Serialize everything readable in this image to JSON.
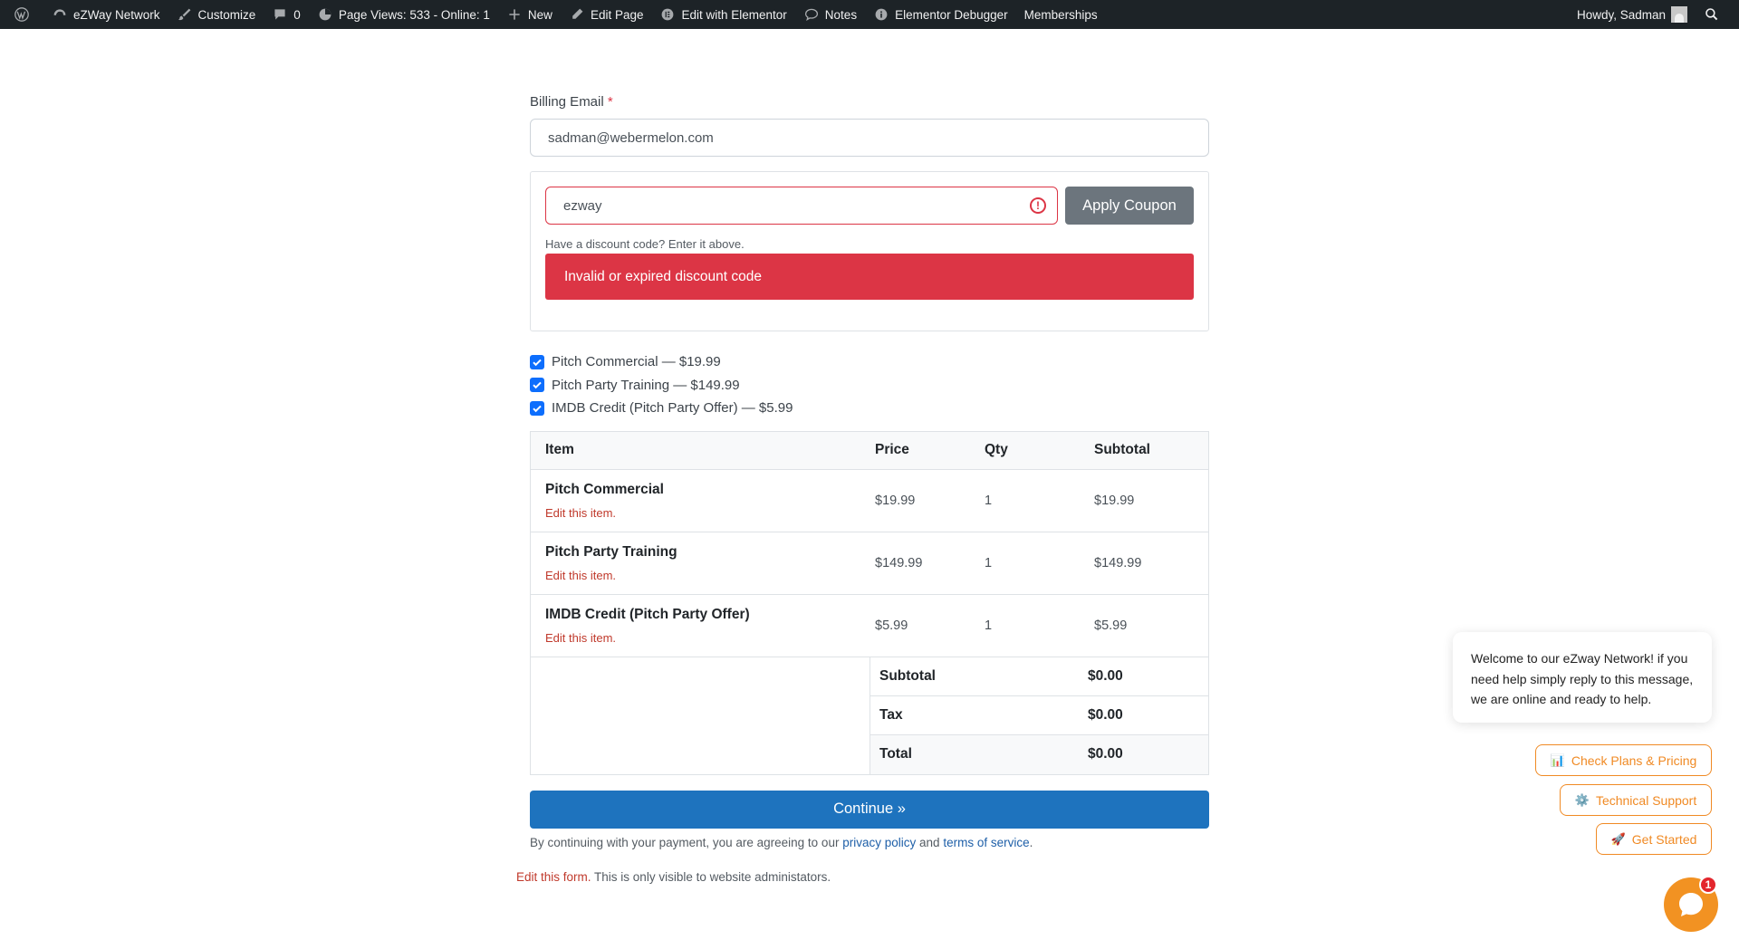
{
  "adminbar": {
    "site_name": "eZWay Network",
    "customize": "Customize",
    "comments_count": "0",
    "page_views": "Page Views: 533 - Online: 1",
    "new": "New",
    "edit_page": "Edit Page",
    "edit_elementor": "Edit with Elementor",
    "notes": "Notes",
    "debugger": "Elementor Debugger",
    "memberships": "Memberships",
    "howdy": "Howdy, Sadman"
  },
  "form": {
    "email_label": "Billing Email",
    "required_mark": "*",
    "email_value": "sadman@webermelon.com",
    "coupon_value": "ezway",
    "apply_label": "Apply Coupon",
    "hint": "Have a discount code? Enter it above.",
    "error": "Invalid or expired discount code",
    "options": [
      {
        "label": "Pitch Commercial — $19.99",
        "checked": true
      },
      {
        "label": "Pitch Party Training — $149.99",
        "checked": true
      },
      {
        "label": "IMDB Credit (Pitch Party Offer) — $5.99",
        "checked": true
      }
    ],
    "table": {
      "headers": {
        "item": "Item",
        "price": "Price",
        "qty": "Qty",
        "subtotal": "Subtotal"
      },
      "rows": [
        {
          "name": "Pitch Commercial",
          "edit": "Edit this item.",
          "price": "$19.99",
          "qty": "1",
          "subtotal": "$19.99"
        },
        {
          "name": "Pitch Party Training",
          "edit": "Edit this item.",
          "price": "$149.99",
          "qty": "1",
          "subtotal": "$149.99"
        },
        {
          "name": "IMDB Credit (Pitch Party Offer)",
          "edit": "Edit this item.",
          "price": "$5.99",
          "qty": "1",
          "subtotal": "$5.99"
        }
      ],
      "totals": [
        {
          "label": "Subtotal",
          "value": "$0.00"
        },
        {
          "label": "Tax",
          "value": "$0.00"
        },
        {
          "label": "Total",
          "value": "$0.00"
        }
      ]
    },
    "continue_label": "Continue »",
    "terms_prefix": "By continuing with your payment, you are agreeing to our",
    "privacy_link": "privacy policy",
    "terms_and": "and",
    "terms_link": "terms of service",
    "terms_suffix": ".",
    "admin_edit_link": "Edit this form.",
    "admin_note": "This is only visible to website administators."
  },
  "chat": {
    "welcome": "Welcome to our eZway Network! if you need help simply reply to this message, we are online and ready to help.",
    "buttons": [
      {
        "icon": "📊",
        "label": "Check Plans & Pricing"
      },
      {
        "icon": "⚙️",
        "label": "Technical Support"
      },
      {
        "icon": "🚀",
        "label": "Get Started"
      }
    ],
    "badge": "1",
    "accent": "#f29222"
  }
}
